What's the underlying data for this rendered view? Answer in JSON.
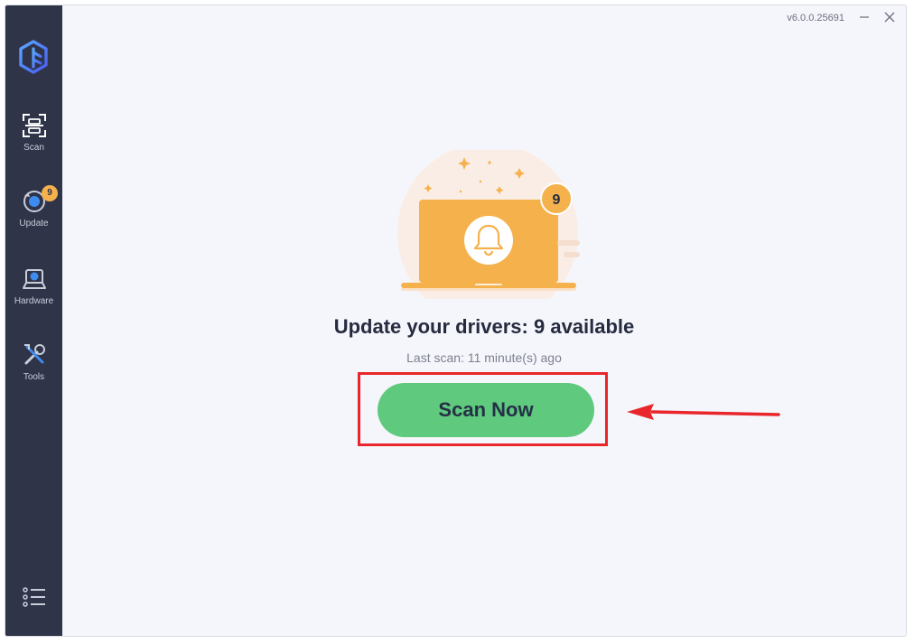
{
  "titlebar": {
    "version": "v6.0.0.25691"
  },
  "sidebar": {
    "items": [
      {
        "label": "Scan",
        "icon": "scan-icon"
      },
      {
        "label": "Update",
        "icon": "update-icon",
        "badge": "9"
      },
      {
        "label": "Hardware",
        "icon": "hardware-icon"
      },
      {
        "label": "Tools",
        "icon": "tools-icon"
      }
    ],
    "menu_icon": "menu-list-icon"
  },
  "main": {
    "badge_count": "9",
    "headline": "Update your drivers: 9 available",
    "last_scan": "Last scan: 11 minute(s) ago",
    "scan_button": "Scan Now"
  },
  "colors": {
    "sidebar_bg": "#2f3449",
    "accent_orange": "#f5b14b",
    "scan_green": "#5fc97d",
    "highlight_red": "#e8262b",
    "brand_blue": "#3f8cf0"
  }
}
